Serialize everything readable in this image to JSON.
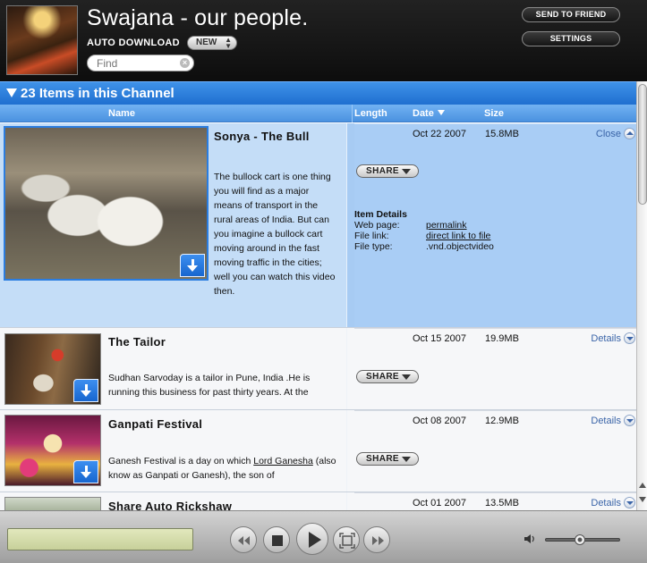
{
  "header": {
    "title": "Swajana - our people.",
    "auto_download_label": "AUTO DOWNLOAD",
    "auto_download_value": "NEW",
    "search_placeholder": "Find",
    "send_to_friend": "SEND TO FRIEND",
    "settings": "SETTINGS"
  },
  "channel": {
    "title": "23 Items in this Channel"
  },
  "columns": {
    "name": "Name",
    "length": "Length",
    "date": "Date",
    "size": "Size"
  },
  "items": [
    {
      "title": "Sonya - The Bull",
      "description": "The bullock cart is one thing you will find as a major means of transport in the rural areas of India. But can you imagine a bullock cart moving around in the fast moving traffic in the cities; well you can watch this video then.",
      "date": "Oct 22 2007",
      "size": "15.8MB",
      "toggle": "Close",
      "share": "SHARE",
      "details": {
        "heading": "Item Details",
        "web_page_label": "Web page:",
        "web_page_value": "permalink",
        "file_link_label": "File link:",
        "file_link_value": "direct link to file",
        "file_type_label": "File type:",
        "file_type_value": ".vnd.objectvideo"
      }
    },
    {
      "title": "The Tailor",
      "description": "Sudhan Sarvoday is a tailor in Pune, India .He is running this business for past thirty years. At the",
      "date": "Oct 15 2007",
      "size": "19.9MB",
      "toggle": "Details",
      "share": "SHARE"
    },
    {
      "title": "Ganpati Festival",
      "description_pre": "Ganesh Festival is a day on which ",
      "description_link": "Lord Ganesha",
      "description_post": " (also know as Ganpati or Ganesh), the son of",
      "date": "Oct 08 2007",
      "size": "12.9MB",
      "toggle": "Details",
      "share": "SHARE"
    },
    {
      "title": "Share Auto Rickshaw",
      "date": "Oct 01 2007",
      "size": "13.5MB",
      "toggle": "Details"
    }
  ],
  "player": {
    "volume_level": 0.45
  },
  "icons": {
    "rewind": "rewind-icon",
    "stop": "stop-icon",
    "play": "play-icon",
    "fullscreen": "fullscreen-icon",
    "fast_forward": "fast-forward-icon",
    "volume": "speaker-icon",
    "download": "download-arrow-icon"
  },
  "colors": {
    "accent": "#2b7de0",
    "channel_bar": "#2f82dd",
    "selected_row": "#a7cbf3"
  }
}
